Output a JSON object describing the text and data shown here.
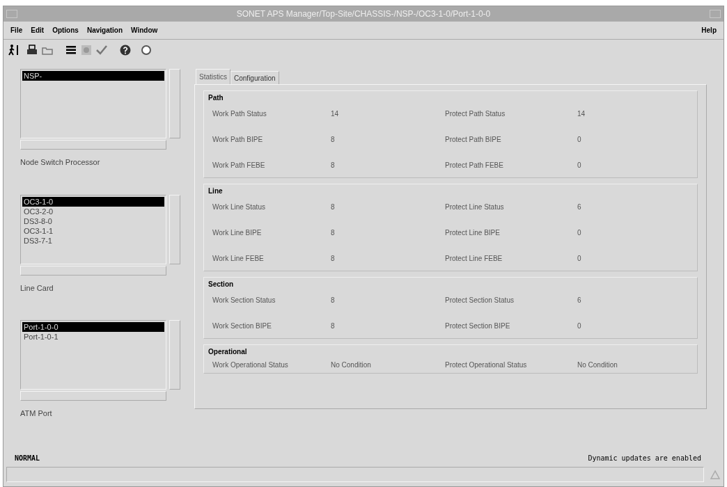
{
  "window": {
    "title": "SONET APS Manager/Top-Site/CHASSIS-/NSP-/OC3-1-0/Port-1-0-0"
  },
  "menu": [
    "File",
    "Edit",
    "Options",
    "Navigation",
    "Window"
  ],
  "help_menu": "Help",
  "lists": [
    {
      "caption": "Node Switch Processor",
      "items": [
        {
          "label": "NSP-",
          "selected": true
        }
      ]
    },
    {
      "caption": "Line Card",
      "items": [
        {
          "label": "OC3-1-0",
          "selected": true
        },
        {
          "label": "OC3-2-0",
          "selected": false
        },
        {
          "label": "DS3-8-0",
          "selected": false
        },
        {
          "label": "OC3-1-1",
          "selected": false
        },
        {
          "label": "DS3-7-1",
          "selected": false
        }
      ]
    },
    {
      "caption": "ATM Port",
      "items": [
        {
          "label": "Port-1-0-0",
          "selected": true
        },
        {
          "label": "Port-1-0-1",
          "selected": false
        }
      ]
    }
  ],
  "tabs": [
    {
      "label": "Statistics",
      "selected": true
    },
    {
      "label": "Configuration",
      "selected": false
    }
  ],
  "sections": [
    {
      "title": "Path",
      "rows": [
        {
          "work_label": "Work Path Status",
          "work_value": "14",
          "protect_label": "Protect Path Status",
          "protect_value": "14"
        },
        {
          "work_label": "Work Path BIPE",
          "work_value": "8",
          "protect_label": "Protect Path BIPE",
          "protect_value": "0"
        },
        {
          "work_label": "Work Path FEBE",
          "work_value": "8",
          "protect_label": "Protect Path FEBE",
          "protect_value": "0"
        }
      ]
    },
    {
      "title": "Line",
      "rows": [
        {
          "work_label": "Work Line Status",
          "work_value": "8",
          "protect_label": "Protect Line Status",
          "protect_value": "6"
        },
        {
          "work_label": "Work Line BIPE",
          "work_value": "8",
          "protect_label": "Protect Line BIPE",
          "protect_value": "0"
        },
        {
          "work_label": "Work Line FEBE",
          "work_value": "8",
          "protect_label": "Protect Line FEBE",
          "protect_value": "0"
        }
      ]
    },
    {
      "title": "Section",
      "rows": [
        {
          "work_label": "Work Section Status",
          "work_value": "8",
          "protect_label": "Protect Section Status",
          "protect_value": "6"
        },
        {
          "work_label": "Work Section BIPE",
          "work_value": "8",
          "protect_label": "Protect Section BIPE",
          "protect_value": "0"
        }
      ]
    },
    {
      "title": "Operational",
      "rows": [
        {
          "work_label": "Work Operational Status",
          "work_value": "No Condition",
          "protect_label": "Protect Operational Status",
          "protect_value": "No Condition"
        }
      ]
    }
  ],
  "status_bar": {
    "mode": "NORMAL",
    "message": "Dynamic updates are enabled"
  }
}
